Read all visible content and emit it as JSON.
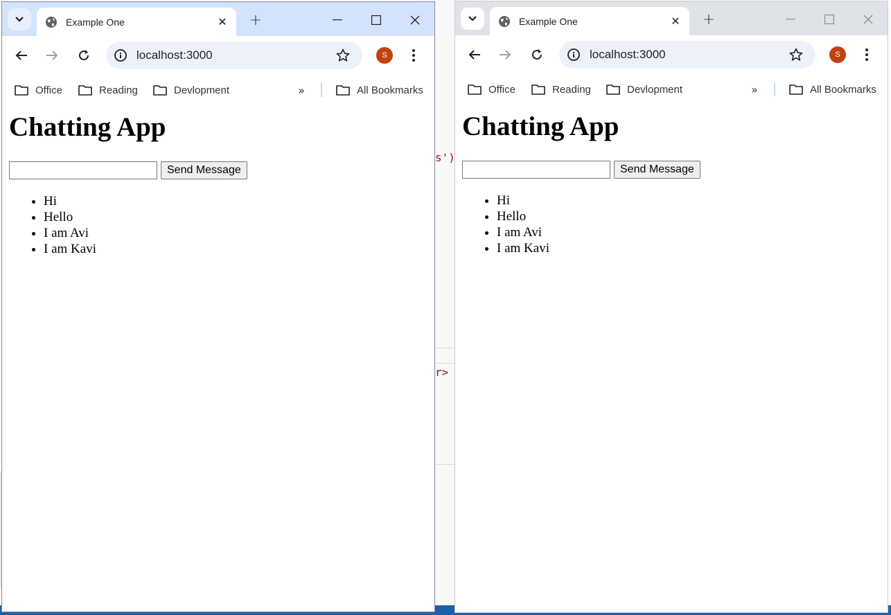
{
  "windows": [
    {
      "tab_title": "Example One",
      "url": "localhost:3000",
      "avatar_initial": "S",
      "bookmarks": [
        "Office",
        "Reading",
        "Devlopment"
      ],
      "all_bookmarks": "All Bookmarks",
      "heading": "Chatting App",
      "input_value": "",
      "send_label": "Send Message",
      "messages": [
        "Hi",
        "Hello",
        "I am Avi",
        "I am Kavi"
      ]
    },
    {
      "tab_title": "Example One",
      "url": "localhost:3000",
      "avatar_initial": "S",
      "bookmarks": [
        "Office",
        "Reading",
        "Devlopment"
      ],
      "all_bookmarks": "All Bookmarks",
      "heading": "Chatting App",
      "input_value": "",
      "send_label": "Send Message",
      "messages": [
        "Hi",
        "Hello",
        "I am Avi",
        "I am Kavi"
      ]
    }
  ],
  "background_code": [
    "s')",
    "r>"
  ],
  "icons": {
    "tab_search": "chevron-down-icon",
    "tab_favicon": "globe-icon",
    "tab_close": "close-icon",
    "new_tab": "plus-icon",
    "back": "arrow-left-icon",
    "forward": "arrow-right-icon",
    "reload": "reload-icon",
    "site_info": "info-icon",
    "bookmark": "star-icon",
    "menu": "kebab-icon",
    "folder": "folder-icon",
    "overflow": "double-chevron-icon"
  },
  "colors": {
    "active_tabstrip": "#d3e3fd",
    "inactive_tabstrip": "#dfe3e8",
    "avatar": "#c2410c",
    "omnibox": "#edf2fa"
  }
}
